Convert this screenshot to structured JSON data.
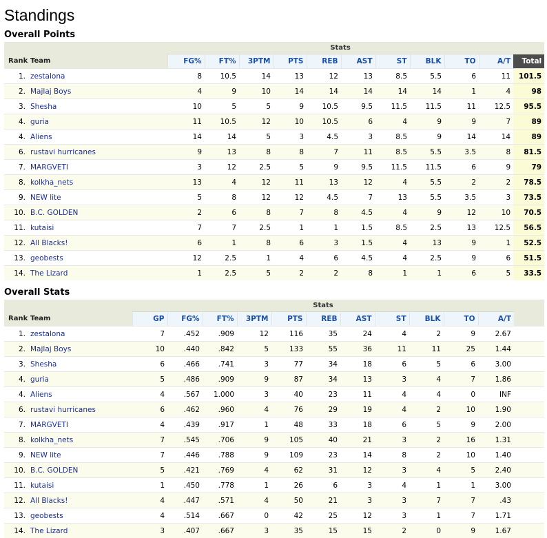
{
  "page_title": "Standings",
  "points_section": {
    "title": "Overall Points",
    "group_label": "Stats",
    "rank_header": "Rank",
    "team_header": "Team",
    "columns": [
      "FG%",
      "FT%",
      "3PTM",
      "PTS",
      "REB",
      "AST",
      "ST",
      "BLK",
      "TO",
      "A/T"
    ],
    "total_header": "Total",
    "rows": [
      {
        "rank": "1.",
        "team": "zestalona",
        "values": [
          "8",
          "10.5",
          "14",
          "13",
          "12",
          "13",
          "8.5",
          "5.5",
          "6",
          "11"
        ],
        "total": "101.5"
      },
      {
        "rank": "2.",
        "team": "Majlaj Boys",
        "values": [
          "4",
          "9",
          "10",
          "14",
          "14",
          "14",
          "14",
          "14",
          "1",
          "4"
        ],
        "total": "98"
      },
      {
        "rank": "3.",
        "team": "Shesha",
        "values": [
          "10",
          "5",
          "5",
          "9",
          "10.5",
          "9.5",
          "11.5",
          "11.5",
          "11",
          "12.5"
        ],
        "total": "95.5"
      },
      {
        "rank": "4.",
        "team": "guria",
        "values": [
          "11",
          "10.5",
          "12",
          "10",
          "10.5",
          "6",
          "4",
          "9",
          "9",
          "7"
        ],
        "total": "89"
      },
      {
        "rank": "4.",
        "team": "Aliens",
        "values": [
          "14",
          "14",
          "5",
          "3",
          "4.5",
          "3",
          "8.5",
          "9",
          "14",
          "14"
        ],
        "total": "89"
      },
      {
        "rank": "6.",
        "team": "rustavi hurricanes",
        "values": [
          "9",
          "13",
          "8",
          "8",
          "7",
          "11",
          "8.5",
          "5.5",
          "3.5",
          "8"
        ],
        "total": "81.5"
      },
      {
        "rank": "7.",
        "team": "MARGVETI",
        "values": [
          "3",
          "12",
          "2.5",
          "5",
          "9",
          "9.5",
          "11.5",
          "11.5",
          "6",
          "9"
        ],
        "total": "79"
      },
      {
        "rank": "8.",
        "team": "kolkha_nets",
        "values": [
          "13",
          "4",
          "12",
          "11",
          "13",
          "12",
          "4",
          "5.5",
          "2",
          "2"
        ],
        "total": "78.5"
      },
      {
        "rank": "9.",
        "team": "NEW lite",
        "values": [
          "5",
          "8",
          "12",
          "12",
          "4.5",
          "7",
          "13",
          "5.5",
          "3.5",
          "3"
        ],
        "total": "73.5"
      },
      {
        "rank": "10.",
        "team": "B.C. GOLDEN",
        "values": [
          "2",
          "6",
          "8",
          "7",
          "8",
          "4.5",
          "4",
          "9",
          "12",
          "10"
        ],
        "total": "70.5"
      },
      {
        "rank": "11.",
        "team": "kutaisi",
        "values": [
          "7",
          "7",
          "2.5",
          "1",
          "1",
          "1.5",
          "8.5",
          "2.5",
          "13",
          "12.5"
        ],
        "total": "56.5"
      },
      {
        "rank": "12.",
        "team": "All Blacks!",
        "values": [
          "6",
          "1",
          "8",
          "6",
          "3",
          "1.5",
          "4",
          "13",
          "9",
          "1"
        ],
        "total": "52.5"
      },
      {
        "rank": "13.",
        "team": "geobests",
        "values": [
          "12",
          "2.5",
          "1",
          "4",
          "6",
          "4.5",
          "4",
          "2.5",
          "9",
          "6"
        ],
        "total": "51.5"
      },
      {
        "rank": "14.",
        "team": "The Lizard",
        "values": [
          "1",
          "2.5",
          "5",
          "2",
          "2",
          "8",
          "1",
          "1",
          "6",
          "5"
        ],
        "total": "33.5"
      }
    ]
  },
  "stats_section": {
    "title": "Overall Stats",
    "group_label": "Stats",
    "rank_header": "Rank",
    "team_header": "Team",
    "columns": [
      "GP",
      "FG%",
      "FT%",
      "3PTM",
      "PTS",
      "REB",
      "AST",
      "ST",
      "BLK",
      "TO",
      "A/T"
    ],
    "rows": [
      {
        "rank": "1.",
        "team": "zestalona",
        "values": [
          "7",
          ".452",
          ".909",
          "12",
          "116",
          "35",
          "24",
          "4",
          "2",
          "9",
          "2.67"
        ]
      },
      {
        "rank": "2.",
        "team": "Majlaj Boys",
        "values": [
          "10",
          ".440",
          ".842",
          "5",
          "133",
          "55",
          "36",
          "11",
          "11",
          "25",
          "1.44"
        ]
      },
      {
        "rank": "3.",
        "team": "Shesha",
        "values": [
          "6",
          ".466",
          ".741",
          "3",
          "77",
          "34",
          "18",
          "6",
          "5",
          "6",
          "3.00"
        ]
      },
      {
        "rank": "4.",
        "team": "guria",
        "values": [
          "5",
          ".486",
          ".909",
          "9",
          "87",
          "34",
          "13",
          "3",
          "4",
          "7",
          "1.86"
        ]
      },
      {
        "rank": "4.",
        "team": "Aliens",
        "values": [
          "4",
          ".567",
          "1.000",
          "3",
          "40",
          "23",
          "11",
          "4",
          "4",
          "0",
          "INF"
        ]
      },
      {
        "rank": "6.",
        "team": "rustavi hurricanes",
        "values": [
          "6",
          ".462",
          ".960",
          "4",
          "76",
          "29",
          "19",
          "4",
          "2",
          "10",
          "1.90"
        ]
      },
      {
        "rank": "7.",
        "team": "MARGVETI",
        "values": [
          "4",
          ".439",
          ".917",
          "1",
          "48",
          "33",
          "18",
          "6",
          "5",
          "9",
          "2.00"
        ]
      },
      {
        "rank": "8.",
        "team": "kolkha_nets",
        "values": [
          "7",
          ".545",
          ".706",
          "9",
          "105",
          "40",
          "21",
          "3",
          "2",
          "16",
          "1.31"
        ]
      },
      {
        "rank": "9.",
        "team": "NEW lite",
        "values": [
          "7",
          ".446",
          ".788",
          "9",
          "109",
          "23",
          "14",
          "8",
          "2",
          "10",
          "1.40"
        ]
      },
      {
        "rank": "10.",
        "team": "B.C. GOLDEN",
        "values": [
          "5",
          ".421",
          ".769",
          "4",
          "62",
          "31",
          "12",
          "3",
          "4",
          "5",
          "2.40"
        ]
      },
      {
        "rank": "11.",
        "team": "kutaisi",
        "values": [
          "1",
          ".450",
          ".778",
          "1",
          "26",
          "6",
          "3",
          "4",
          "1",
          "1",
          "3.00"
        ]
      },
      {
        "rank": "12.",
        "team": "All Blacks!",
        "values": [
          "4",
          ".447",
          ".571",
          "4",
          "50",
          "21",
          "3",
          "3",
          "7",
          "7",
          ".43"
        ]
      },
      {
        "rank": "13.",
        "team": "geobests",
        "values": [
          "4",
          ".514",
          ".667",
          "0",
          "42",
          "25",
          "12",
          "3",
          "1",
          "7",
          "1.71"
        ]
      },
      {
        "rank": "14.",
        "team": "The Lizard",
        "values": [
          "3",
          ".407",
          ".667",
          "3",
          "35",
          "15",
          "15",
          "2",
          "0",
          "9",
          "1.67"
        ]
      }
    ]
  }
}
